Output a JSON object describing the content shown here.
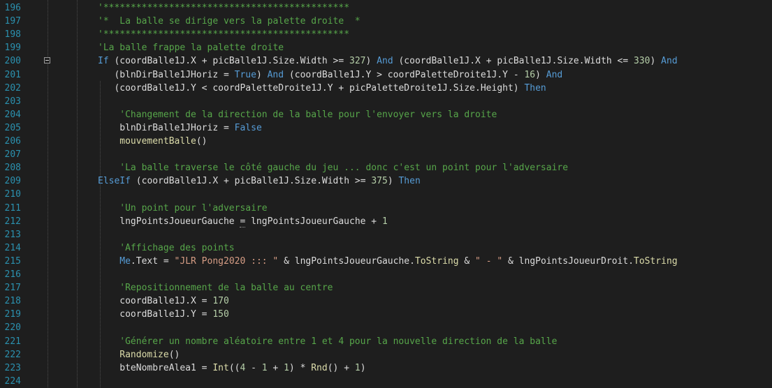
{
  "colors": {
    "background": "#1e1e1e",
    "line_number": "#2b91af",
    "comment": "#57a64a",
    "keyword": "#569cd6",
    "function": "#dcdcaa",
    "number": "#b5cea8",
    "string": "#d69d85",
    "identifier": "#dcdcdc"
  },
  "lines": [
    {
      "n": "196",
      "indent": 0,
      "tokens": [
        [
          "cm",
          "'*********************************************"
        ]
      ]
    },
    {
      "n": "197",
      "indent": 0,
      "tokens": [
        [
          "cm",
          "'*  La balle se dirige vers la palette droite  *"
        ]
      ]
    },
    {
      "n": "198",
      "indent": 0,
      "tokens": [
        [
          "cm",
          "'*********************************************"
        ]
      ]
    },
    {
      "n": "199",
      "indent": 0,
      "tokens": [
        [
          "cm",
          "'La balle frappe la palette droite"
        ]
      ]
    },
    {
      "n": "200",
      "indent": 0,
      "tokens": [
        [
          "kw",
          "If"
        ],
        [
          "id",
          " (coordBalle1J.X + picBalle1J.Size.Width >= "
        ],
        [
          "num",
          "327"
        ],
        [
          "id",
          ") "
        ],
        [
          "kw",
          "And"
        ],
        [
          "id",
          " (coordBalle1J.X + picBalle1J.Size.Width <= "
        ],
        [
          "num",
          "330"
        ],
        [
          "id",
          ") "
        ],
        [
          "kw",
          "And"
        ]
      ]
    },
    {
      "n": "201",
      "indent": 3,
      "tokens": [
        [
          "id",
          "(blnDirBalle1JHoriz = "
        ],
        [
          "kw",
          "True"
        ],
        [
          "id",
          ") "
        ],
        [
          "kw",
          "And"
        ],
        [
          "id",
          " (coordBalle1J.Y > coordPaletteDroite1J.Y - "
        ],
        [
          "num",
          "16"
        ],
        [
          "id",
          ") "
        ],
        [
          "kw",
          "And"
        ]
      ]
    },
    {
      "n": "202",
      "indent": 3,
      "tokens": [
        [
          "id",
          "(coordBalle1J.Y < coordPaletteDroite1J.Y + picPaletteDroite1J.Size.Height) "
        ],
        [
          "kw",
          "Then"
        ]
      ]
    },
    {
      "n": "203",
      "indent": 0,
      "tokens": []
    },
    {
      "n": "204",
      "indent": 4,
      "tokens": [
        [
          "cm",
          "'Changement de la direction de la balle pour l'envoyer vers la droite"
        ]
      ]
    },
    {
      "n": "205",
      "indent": 4,
      "tokens": [
        [
          "id",
          "blnDirBalle1JHoriz = "
        ],
        [
          "kw",
          "False"
        ]
      ]
    },
    {
      "n": "206",
      "indent": 4,
      "tokens": [
        [
          "fn",
          "mouvementBalle"
        ],
        [
          "id",
          "()"
        ]
      ]
    },
    {
      "n": "207",
      "indent": 0,
      "tokens": []
    },
    {
      "n": "208",
      "indent": 4,
      "tokens": [
        [
          "cm",
          "'La balle traverse le côté gauche du jeu ... donc c'est un point pour l'adversaire"
        ]
      ]
    },
    {
      "n": "209",
      "indent": 0,
      "tokens": [
        [
          "kw",
          "ElseIf"
        ],
        [
          "id",
          " (coordBalle1J.X + picBalle1J.Size.Width >= "
        ],
        [
          "num",
          "375"
        ],
        [
          "id",
          ") "
        ],
        [
          "kw",
          "Then"
        ]
      ]
    },
    {
      "n": "210",
      "indent": 0,
      "tokens": []
    },
    {
      "n": "211",
      "indent": 4,
      "tokens": [
        [
          "cm",
          "'Un point pour l'adversaire"
        ]
      ]
    },
    {
      "n": "212",
      "indent": 4,
      "tokens": [
        [
          "id",
          "lngPointsJoueurGauche "
        ],
        [
          "sq",
          "="
        ],
        [
          "id",
          " lngPointsJoueurGauche + "
        ],
        [
          "num",
          "1"
        ]
      ]
    },
    {
      "n": "213",
      "indent": 0,
      "tokens": []
    },
    {
      "n": "214",
      "indent": 4,
      "tokens": [
        [
          "cm",
          "'Affichage des points"
        ]
      ]
    },
    {
      "n": "215",
      "indent": 4,
      "tokens": [
        [
          "kw",
          "Me"
        ],
        [
          "id",
          ".Text = "
        ],
        [
          "str",
          "\"JLR Pong2020 ::: \""
        ],
        [
          "id",
          " & lngPointsJoueurGauche."
        ],
        [
          "fn",
          "ToString"
        ],
        [
          "id",
          " & "
        ],
        [
          "str",
          "\" - \""
        ],
        [
          "id",
          " & lngPointsJoueurDroit."
        ],
        [
          "fn",
          "ToString"
        ]
      ]
    },
    {
      "n": "216",
      "indent": 0,
      "tokens": []
    },
    {
      "n": "217",
      "indent": 4,
      "tokens": [
        [
          "cm",
          "'Repositionnement de la balle au centre"
        ]
      ]
    },
    {
      "n": "218",
      "indent": 4,
      "tokens": [
        [
          "id",
          "coordBalle1J.X = "
        ],
        [
          "num",
          "170"
        ]
      ]
    },
    {
      "n": "219",
      "indent": 4,
      "tokens": [
        [
          "id",
          "coordBalle1J.Y = "
        ],
        [
          "num",
          "150"
        ]
      ]
    },
    {
      "n": "220",
      "indent": 0,
      "tokens": []
    },
    {
      "n": "221",
      "indent": 4,
      "tokens": [
        [
          "cm",
          "'Générer un nombre aléatoire entre 1 et 4 pour la nouvelle direction de la balle"
        ]
      ]
    },
    {
      "n": "222",
      "indent": 4,
      "tokens": [
        [
          "fn",
          "Randomize"
        ],
        [
          "id",
          "()"
        ]
      ]
    },
    {
      "n": "223",
      "indent": 4,
      "tokens": [
        [
          "id",
          "bteNombreAlea1 = "
        ],
        [
          "fn",
          "Int"
        ],
        [
          "id",
          "(("
        ],
        [
          "num",
          "4"
        ],
        [
          "id",
          " - "
        ],
        [
          "num",
          "1"
        ],
        [
          "id",
          " + "
        ],
        [
          "num",
          "1"
        ],
        [
          "id",
          ") * "
        ],
        [
          "fn",
          "Rnd"
        ],
        [
          "id",
          "() + "
        ],
        [
          "num",
          "1"
        ],
        [
          "id",
          ")"
        ]
      ]
    },
    {
      "n": "224",
      "indent": 0,
      "tokens": []
    }
  ]
}
